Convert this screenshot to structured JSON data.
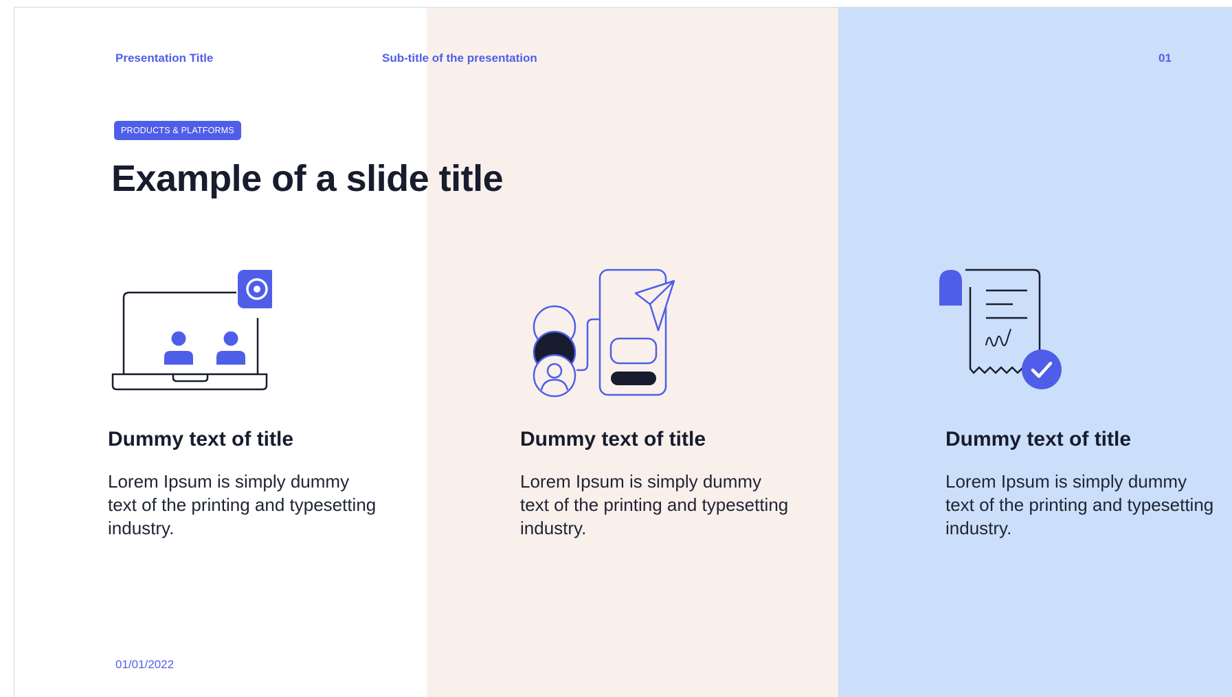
{
  "header": {
    "presentation_title": "Presentation Title",
    "subtitle": "Sub-title of the presentation",
    "page_number": "01"
  },
  "tag": "PRODUCTS & PLATFORMS",
  "slide_title": "Example of a slide title",
  "cards": [
    {
      "icon": "laptop-video-meeting-icon",
      "title": "Dummy text of title",
      "body": "Lorem Ipsum is simply dummy text of the printing and typesetting industry."
    },
    {
      "icon": "mobile-send-message-icon",
      "title": "Dummy text of title",
      "body": "Lorem Ipsum is simply dummy text of the printing and typesetting industry."
    },
    {
      "icon": "signed-receipt-check-icon",
      "title": "Dummy text of title",
      "body": "Lorem Ipsum is simply dummy text of the printing and typesetting industry."
    }
  ],
  "date": "01/01/2022",
  "colors": {
    "accent": "#4f5ee8",
    "dark": "#171c2e",
    "middle_column_bg": "#f9f0ec",
    "right_column_bg": "#cbdffa"
  }
}
